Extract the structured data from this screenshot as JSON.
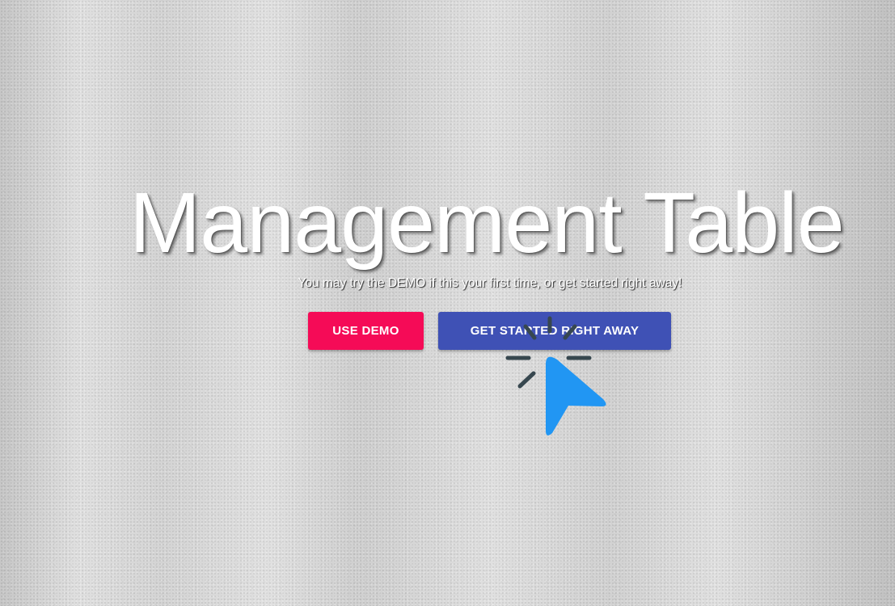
{
  "hero": {
    "title": "Management Table",
    "subtitle": "You may try the DEMO if this your first time, or get started right away!"
  },
  "actions": {
    "demo_label": "USE DEMO",
    "start_label": "GET STARTED RIGHT AWAY"
  },
  "colors": {
    "demo_button": "#f50b57",
    "start_button": "#3f51b5",
    "cursor": "#2196f3",
    "click_burst": "#37474f"
  },
  "icons": {
    "pointer": "click-cursor-icon"
  }
}
